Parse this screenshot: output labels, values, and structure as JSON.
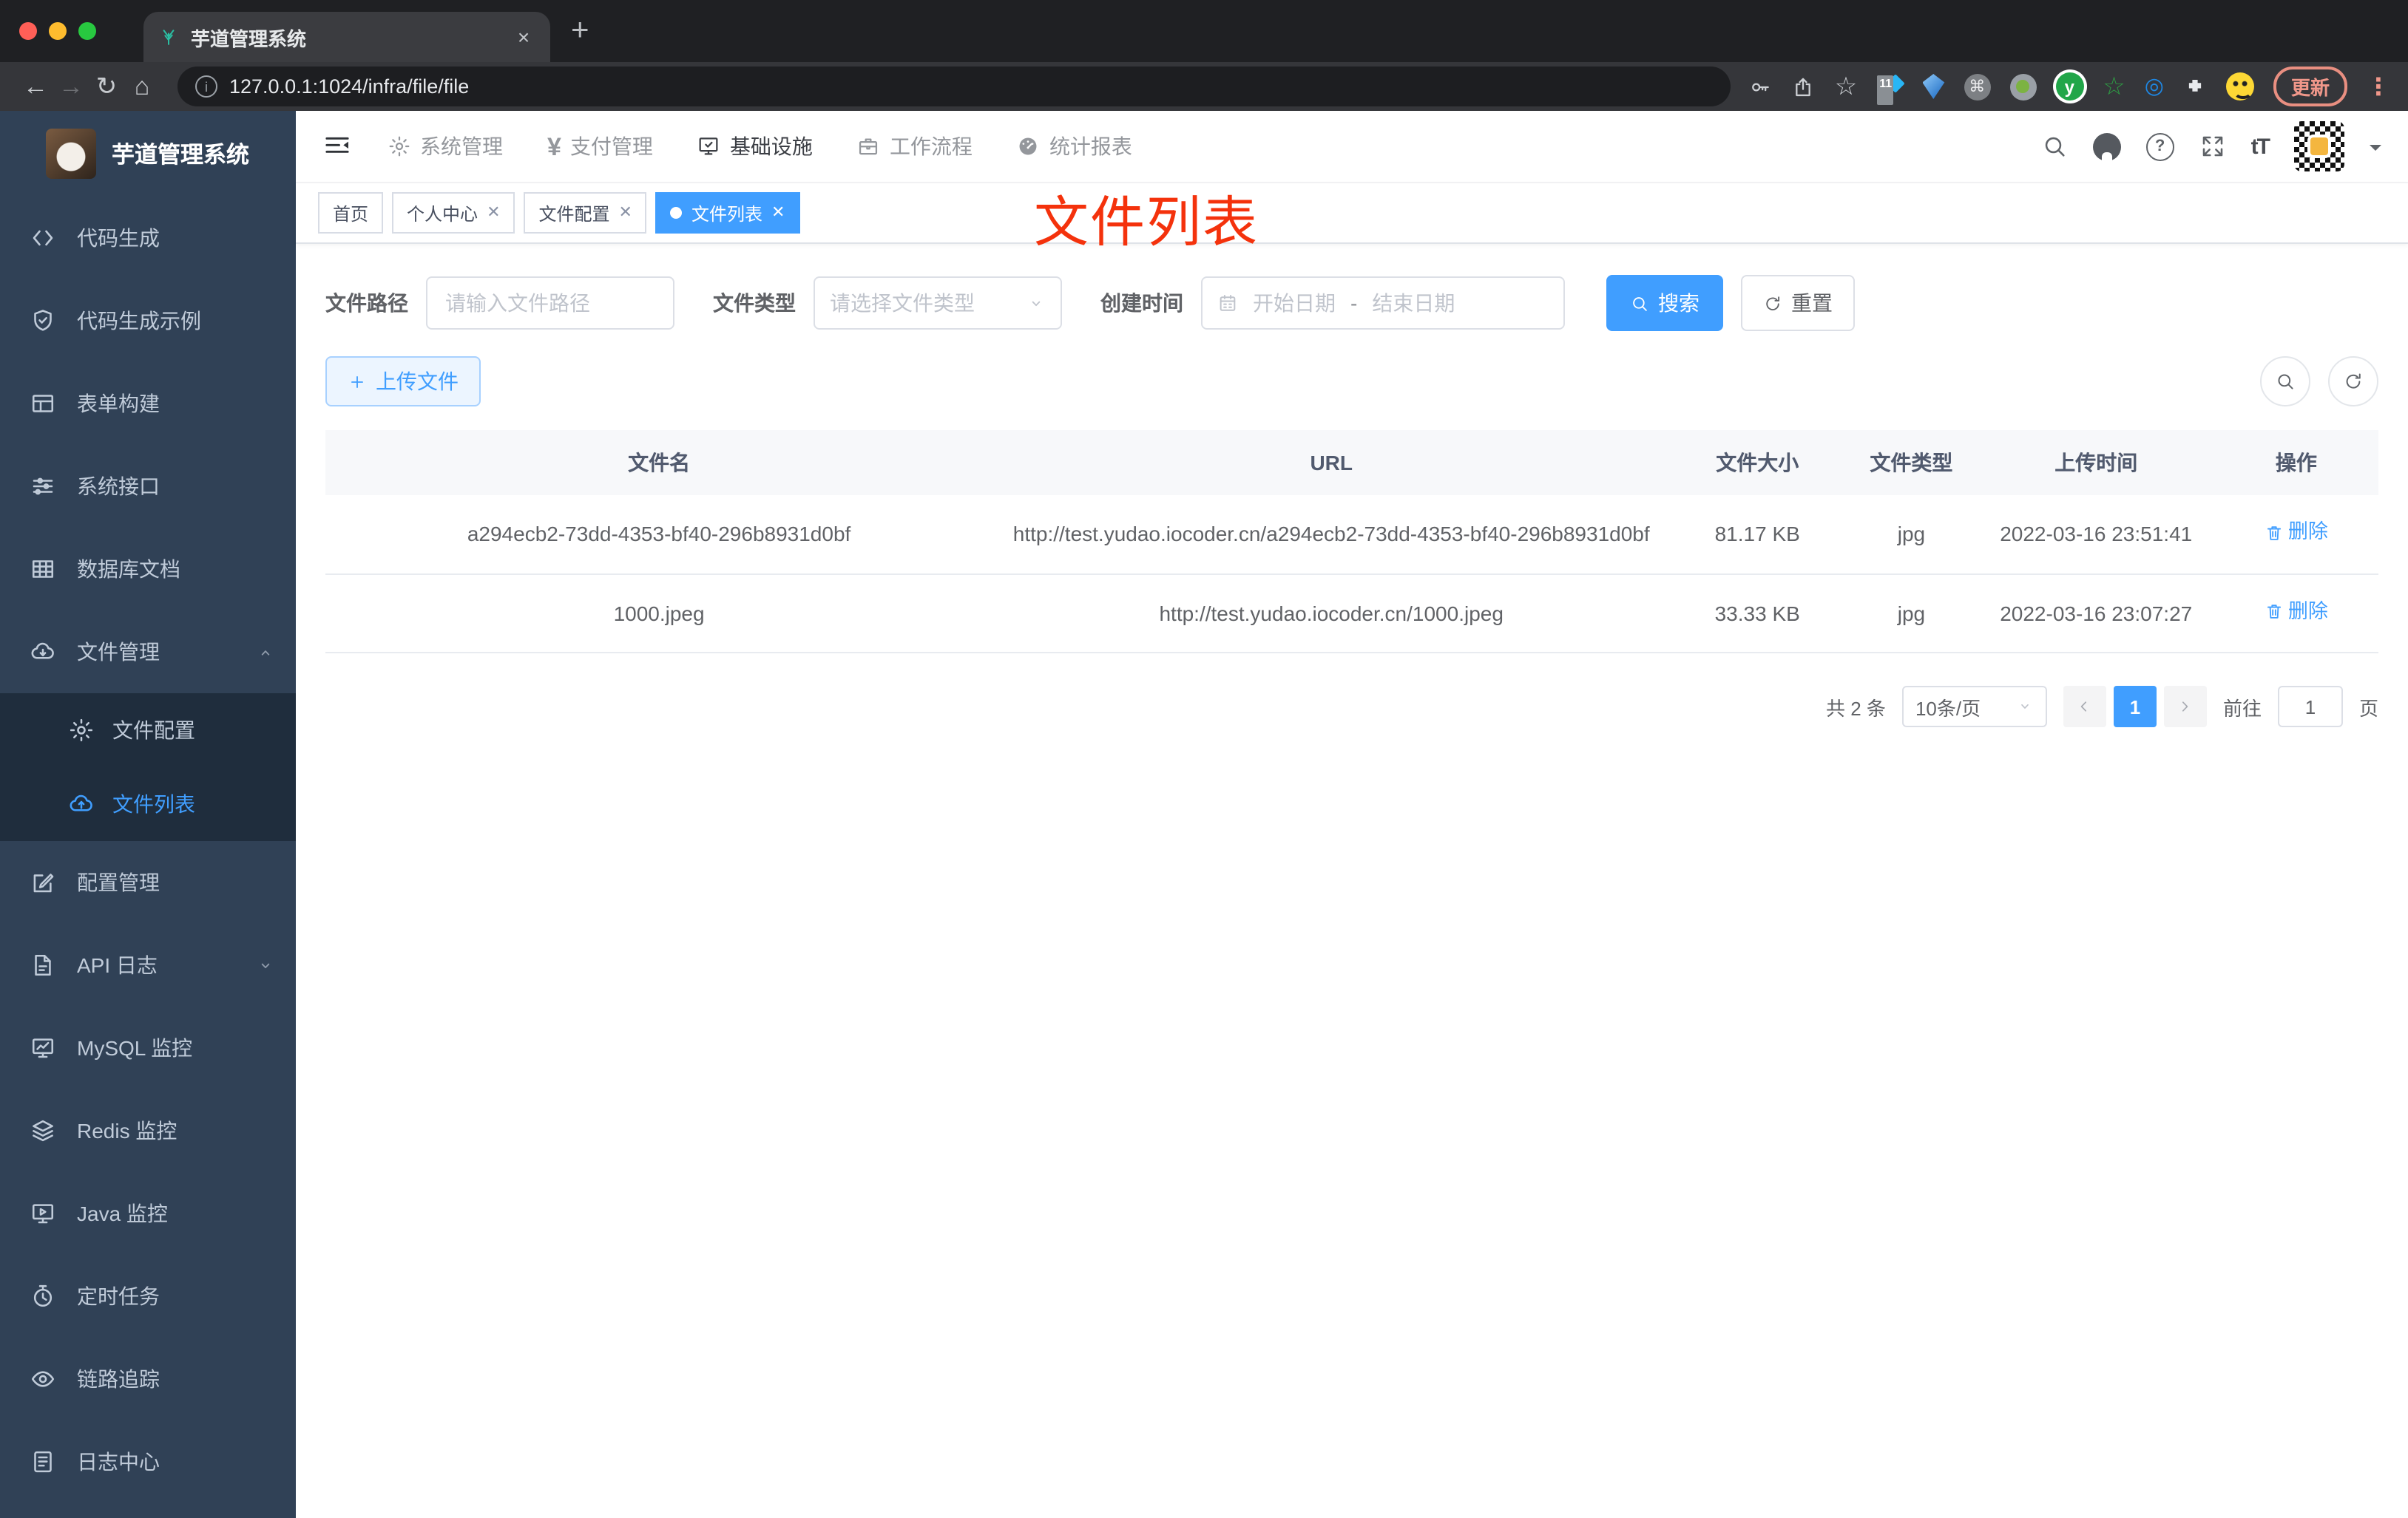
{
  "browser": {
    "tab_title": "芋道管理系统",
    "url": "127.0.0.1:1024/infra/file/file",
    "update_label": "更新",
    "ext_badge": "11"
  },
  "sidebar": {
    "title": "芋道管理系统",
    "menu": [
      {
        "label": "代码生成"
      },
      {
        "label": "代码生成示例"
      },
      {
        "label": "表单构建"
      },
      {
        "label": "系统接口"
      },
      {
        "label": "数据库文档"
      },
      {
        "label": "文件管理"
      },
      {
        "label": "配置管理"
      },
      {
        "label": "API 日志"
      },
      {
        "label": "MySQL 监控"
      },
      {
        "label": "Redis 监控"
      },
      {
        "label": "Java 监控"
      },
      {
        "label": "定时任务"
      },
      {
        "label": "链路追踪"
      },
      {
        "label": "日志中心"
      }
    ],
    "submenu": [
      {
        "label": "文件配置"
      },
      {
        "label": "文件列表"
      }
    ]
  },
  "topnav": {
    "items": [
      {
        "label": "系统管理"
      },
      {
        "label": "支付管理"
      },
      {
        "label": "基础设施"
      },
      {
        "label": "工作流程"
      },
      {
        "label": "统计报表"
      }
    ]
  },
  "tags": [
    {
      "label": "首页"
    },
    {
      "label": "个人中心"
    },
    {
      "label": "文件配置"
    },
    {
      "label": "文件列表"
    }
  ],
  "annotation": {
    "text": "文件列表"
  },
  "filter": {
    "path_label": "文件路径",
    "path_placeholder": "请输入文件路径",
    "type_label": "文件类型",
    "type_placeholder": "请选择文件类型",
    "date_label": "创建时间",
    "date_start": "开始日期",
    "date_sep": "-",
    "date_end": "结束日期",
    "search_label": "搜索",
    "reset_label": "重置"
  },
  "toolbar": {
    "upload_label": "上传文件"
  },
  "table": {
    "headers": [
      "文件名",
      "URL",
      "文件大小",
      "文件类型",
      "上传时间",
      "操作"
    ],
    "rows": [
      {
        "name": "a294ecb2-73dd-4353-bf40-296b8931d0bf",
        "url": "http://test.yudao.iocoder.cn/a294ecb2-73dd-4353-bf40-296b8931d0bf",
        "size": "81.17 KB",
        "type": "jpg",
        "time": "2022-03-16 23:51:41",
        "action": "删除"
      },
      {
        "name": "1000.jpeg",
        "url": "http://test.yudao.iocoder.cn/1000.jpeg",
        "size": "33.33 KB",
        "type": "jpg",
        "time": "2022-03-16 23:07:27",
        "action": "删除"
      }
    ]
  },
  "pagination": {
    "total": "共 2 条",
    "page_size": "10条/页",
    "current": "1",
    "goto_label": "前往",
    "goto_value": "1",
    "page_label": "页"
  },
  "colors": {
    "accent": "#409eff",
    "sidebar_bg": "#304156",
    "submenu_bg": "#1f2d3d",
    "annotation_red": "#f4320c"
  }
}
